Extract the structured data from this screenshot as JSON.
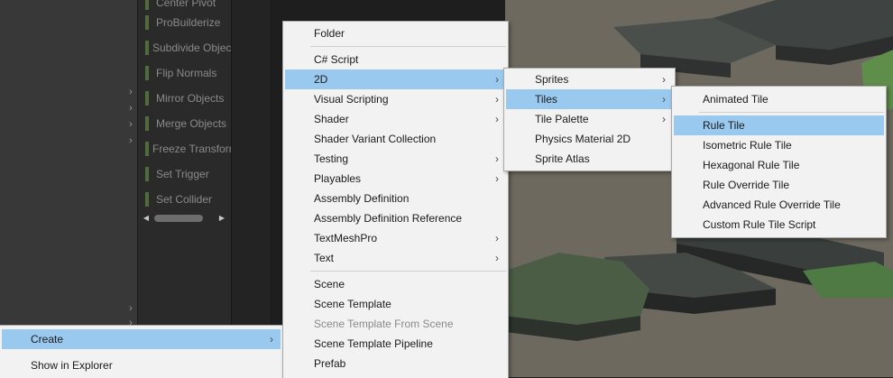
{
  "probuilder": {
    "items": [
      {
        "label": "Center Pivot"
      },
      {
        "label": "ProBuilderize"
      },
      {
        "label": "Subdivide Objects"
      },
      {
        "label": "Flip Normals"
      },
      {
        "label": "Mirror Objects"
      },
      {
        "label": "Merge Objects"
      },
      {
        "label": "Freeze Transform"
      },
      {
        "label": "Set Trigger"
      },
      {
        "label": "Set Collider"
      }
    ]
  },
  "context_menu": {
    "items": [
      {
        "label": "Create",
        "arrow": "›"
      },
      {
        "label": "Show in Explorer"
      }
    ]
  },
  "create_menu": {
    "items": [
      {
        "label": "Folder"
      },
      {
        "label": "C# Script"
      },
      {
        "label": "2D",
        "arrow": "›"
      },
      {
        "label": "Visual Scripting",
        "arrow": "›"
      },
      {
        "label": "Shader",
        "arrow": "›"
      },
      {
        "label": "Shader Variant Collection"
      },
      {
        "label": "Testing",
        "arrow": "›"
      },
      {
        "label": "Playables",
        "arrow": "›"
      },
      {
        "label": "Assembly Definition"
      },
      {
        "label": "Assembly Definition Reference"
      },
      {
        "label": "TextMeshPro",
        "arrow": "›"
      },
      {
        "label": "Text",
        "arrow": "›"
      },
      {
        "label": "Scene"
      },
      {
        "label": "Scene Template"
      },
      {
        "label": "Scene Template From Scene"
      },
      {
        "label": "Scene Template Pipeline"
      },
      {
        "label": "Prefab"
      }
    ]
  },
  "menu_2d": {
    "items": [
      {
        "label": "Sprites",
        "arrow": "›"
      },
      {
        "label": "Tiles",
        "arrow": "›"
      },
      {
        "label": "Tile Palette",
        "arrow": "›"
      },
      {
        "label": "Physics Material 2D"
      },
      {
        "label": "Sprite Atlas"
      }
    ]
  },
  "menu_tiles": {
    "items": [
      {
        "label": "Animated Tile"
      },
      {
        "label": "Rule Tile"
      },
      {
        "label": "Isometric Rule Tile"
      },
      {
        "label": "Hexagonal Rule Tile"
      },
      {
        "label": "Rule Override Tile"
      },
      {
        "label": "Advanced Rule Override Tile"
      },
      {
        "label": "Custom Rule Tile Script"
      }
    ]
  },
  "colors": {
    "highlight": "#99c9ef",
    "menu_bg": "#f2f2f2",
    "probuilder_bar": "#4f6c3a"
  }
}
